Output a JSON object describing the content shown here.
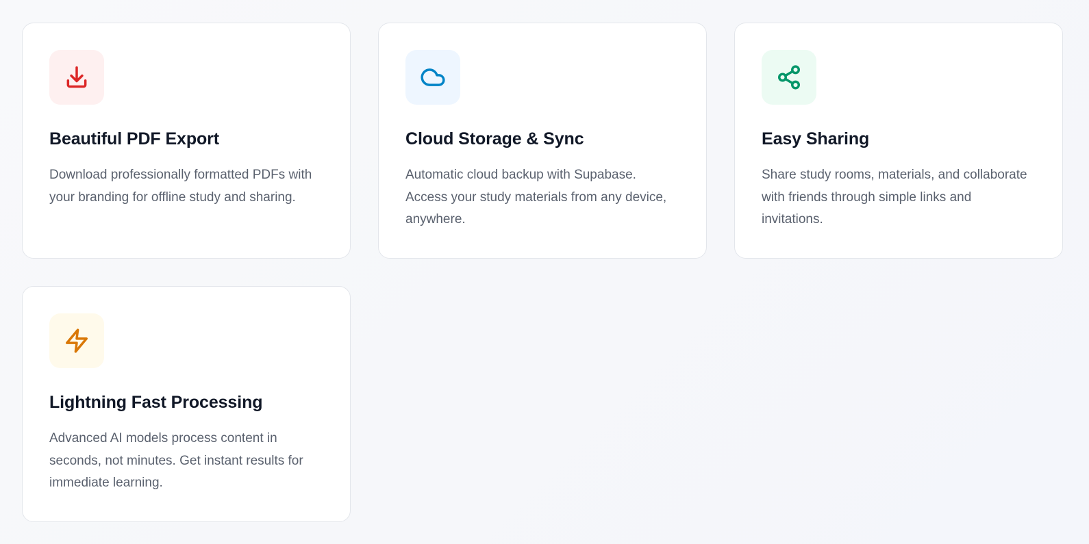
{
  "features": [
    {
      "title": "Beautiful PDF Export",
      "description": "Download professionally formatted PDFs with your branding for offline study and sharing.",
      "icon": "download-icon",
      "icon_color": "#dc2626",
      "icon_bg": "#fef0f0"
    },
    {
      "title": "Cloud Storage & Sync",
      "description": "Automatic cloud backup with Supabase. Access your study materials from any device, anywhere.",
      "icon": "cloud-icon",
      "icon_color": "#0284c7",
      "icon_bg": "#eef6ff"
    },
    {
      "title": "Easy Sharing",
      "description": "Share study rooms, materials, and collaborate with friends through simple links and invitations.",
      "icon": "share-icon",
      "icon_color": "#059669",
      "icon_bg": "#ecfbf3"
    },
    {
      "title": "Lightning Fast Processing",
      "description": "Advanced AI models process content in seconds, not minutes. Get instant results for immediate learning.",
      "icon": "lightning-icon",
      "icon_color": "#d97706",
      "icon_bg": "#fffaeb"
    }
  ]
}
